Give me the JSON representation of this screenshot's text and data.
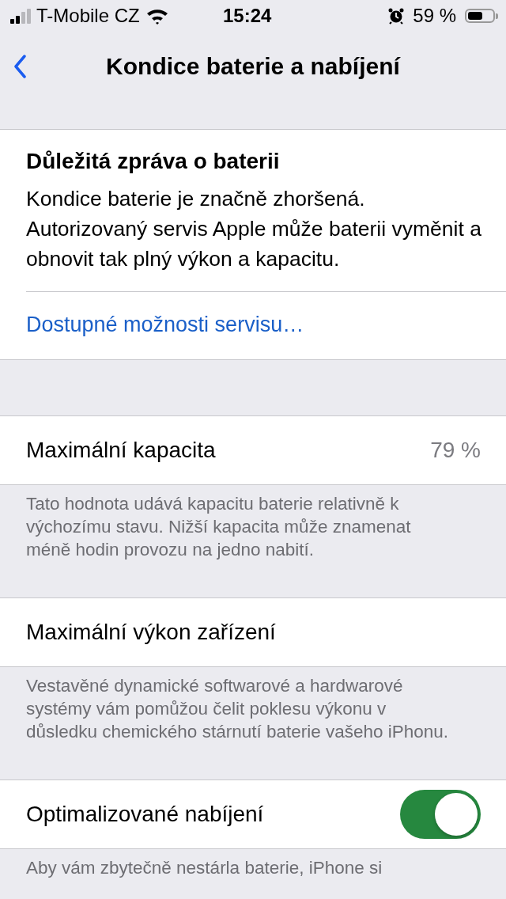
{
  "status_bar": {
    "carrier": "T-Mobile CZ",
    "time": "15:24",
    "battery_percent": "59 %"
  },
  "nav": {
    "title": "Kondice baterie a nabíjení"
  },
  "message_card": {
    "title": "Důležitá zpráva o baterii",
    "body": "Kondice baterie je značně zhoršená. Autorizovaný servis Apple může baterii vyměnit a obnovit tak plný výkon a kapacitu.",
    "link": "Dostupné možnosti servisu…"
  },
  "sections": [
    {
      "kind": "value",
      "label": "Maximální kapacita",
      "value": "79 %",
      "footer": "Tato hodnota udává kapacitu baterie relativně k výchozímu stavu. Nižší kapacita může znamenat méně hodin provozu na jedno nabití."
    },
    {
      "kind": "plain",
      "label": "Maximální výkon zařízení",
      "footer": "Vestavěné dynamické softwarové a hardwarové systémy vám pomůžou čelit poklesu výkonu v důsledku chemického stárnutí baterie vašeho iPhonu."
    },
    {
      "kind": "toggle",
      "label": "Optimalizované nabíjení",
      "on": true,
      "footer": "Aby vám zbytečně nestárla baterie, iPhone si"
    }
  ]
}
